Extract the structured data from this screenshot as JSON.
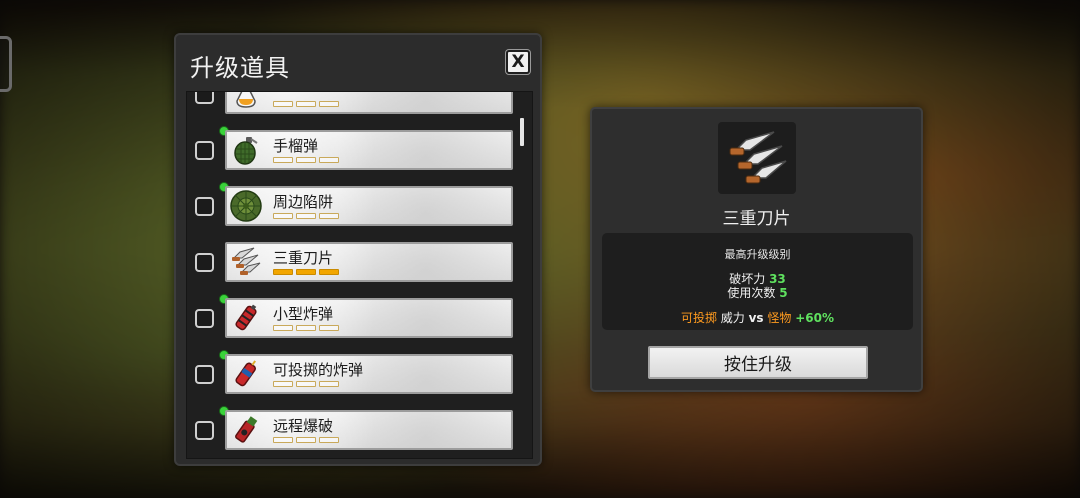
{
  "upgrade_panel": {
    "title": "升级道具",
    "close_label": "X",
    "items": [
      {
        "name": "",
        "icon": "potion-icon",
        "level": 0,
        "max_level": 3,
        "is_new": false,
        "checked": false
      },
      {
        "name": "手榴弹",
        "icon": "grenade-icon",
        "level": 0,
        "max_level": 3,
        "is_new": true,
        "checked": false
      },
      {
        "name": "周边陷阱",
        "icon": "landmine-icon",
        "level": 0,
        "max_level": 3,
        "is_new": true,
        "checked": false
      },
      {
        "name": "三重刀片",
        "icon": "triple-blades-icon",
        "level": 3,
        "max_level": 3,
        "is_new": false,
        "checked": false
      },
      {
        "name": "小型炸弹",
        "icon": "small-bomb-icon",
        "level": 0,
        "max_level": 3,
        "is_new": true,
        "checked": false
      },
      {
        "name": "可投掷的炸弹",
        "icon": "throwable-bomb-icon",
        "level": 0,
        "max_level": 3,
        "is_new": true,
        "checked": false
      },
      {
        "name": "远程爆破",
        "icon": "remote-detonator-icon",
        "level": 0,
        "max_level": 3,
        "is_new": true,
        "checked": false
      }
    ]
  },
  "detail": {
    "icon": "triple-blades-icon",
    "name": "三重刀片",
    "max_level_text": "最高升级级别",
    "damage_label": "破坏力",
    "damage_value": "33",
    "uses_label": "使用次数",
    "uses_value": "5",
    "bonus_type": "可投掷",
    "bonus_mid": " 威力 ",
    "bonus_vs": "vs",
    "bonus_target": "怪物",
    "bonus_value": "+60%",
    "hold_button_label": "按住升级"
  },
  "colors": {
    "pip_filled": "#f2a600",
    "new_dot": "#3ad23a",
    "stat_green": "#5fe15f",
    "bonus_orange": "#ff9b1f"
  }
}
